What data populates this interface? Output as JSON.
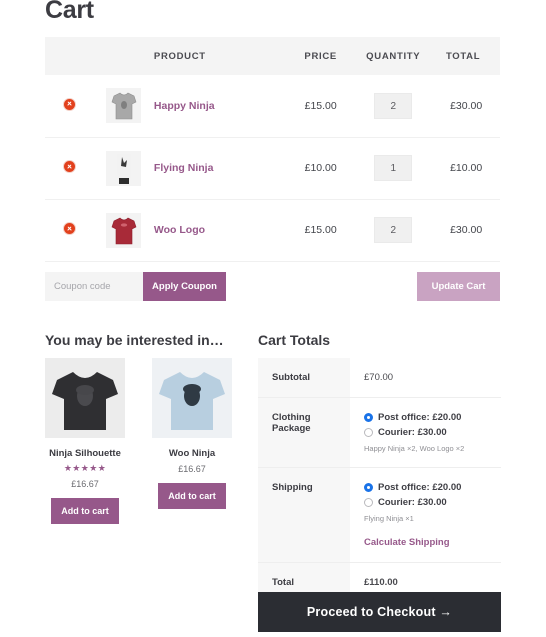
{
  "page": {
    "title": "Cart"
  },
  "cart_table": {
    "headers": {
      "remove": "",
      "thumbnail": "",
      "product": "PRODUCT",
      "price": "PRICE",
      "quantity": "QUANTITY",
      "total": "TOTAL"
    },
    "rows": [
      {
        "remove_icon": "remove-icon",
        "thumb": "grey-tshirt",
        "product": "Happy Ninja",
        "price": "£15.00",
        "quantity": "2",
        "total": "£30.00"
      },
      {
        "remove_icon": "remove-icon",
        "thumb": "white-tshirt",
        "product": "Flying Ninja",
        "price": "£10.00",
        "quantity": "1",
        "total": "£10.00"
      },
      {
        "remove_icon": "remove-icon",
        "thumb": "red-tshirt",
        "product": "Woo Logo",
        "price": "£15.00",
        "quantity": "2",
        "total": "£30.00"
      }
    ]
  },
  "coupon": {
    "placeholder": "Coupon code",
    "value": "",
    "apply_label": "Apply Coupon",
    "update_label": "Update Cart"
  },
  "related": {
    "heading": "You may be interested in…",
    "products": [
      {
        "name": "Ninja Silhouette",
        "stars": "★★★★★",
        "rating": 5,
        "price": "£16.67",
        "button": "Add to cart",
        "shirt_color": "#2f2f32"
      },
      {
        "name": "Woo Ninja",
        "stars": "",
        "rating": 0,
        "price": "£16.67",
        "button": "Add to cart",
        "shirt_color": "#b8cfe0"
      }
    ]
  },
  "totals": {
    "heading": "Cart Totals",
    "subtotal": {
      "label": "Subtotal",
      "value": "£70.00"
    },
    "clothing_package": {
      "label": "Clothing Package",
      "options": [
        {
          "label": "Post office: £20.00",
          "selected": true
        },
        {
          "label": "Courier: £30.00",
          "selected": false
        }
      ],
      "items": "Happy Ninja ×2, Woo Logo ×2"
    },
    "shipping": {
      "label": "Shipping",
      "options": [
        {
          "label": "Post office: £20.00",
          "selected": true
        },
        {
          "label": "Courier: £30.00",
          "selected": false
        }
      ],
      "items": "Flying Ninja ×1",
      "calculate_link": "Calculate Shipping"
    },
    "total": {
      "label": "Total",
      "value": "£110.00"
    }
  },
  "checkout": {
    "label": "Proceed to Checkout  →"
  },
  "colors": {
    "accent": "#96588a",
    "accent_muted": "#c9a3c2",
    "remove": "#e2401c",
    "radio_selected": "#1a73e8",
    "checkout_bg": "#2b2d33",
    "header_bg": "#f4f4f4"
  }
}
